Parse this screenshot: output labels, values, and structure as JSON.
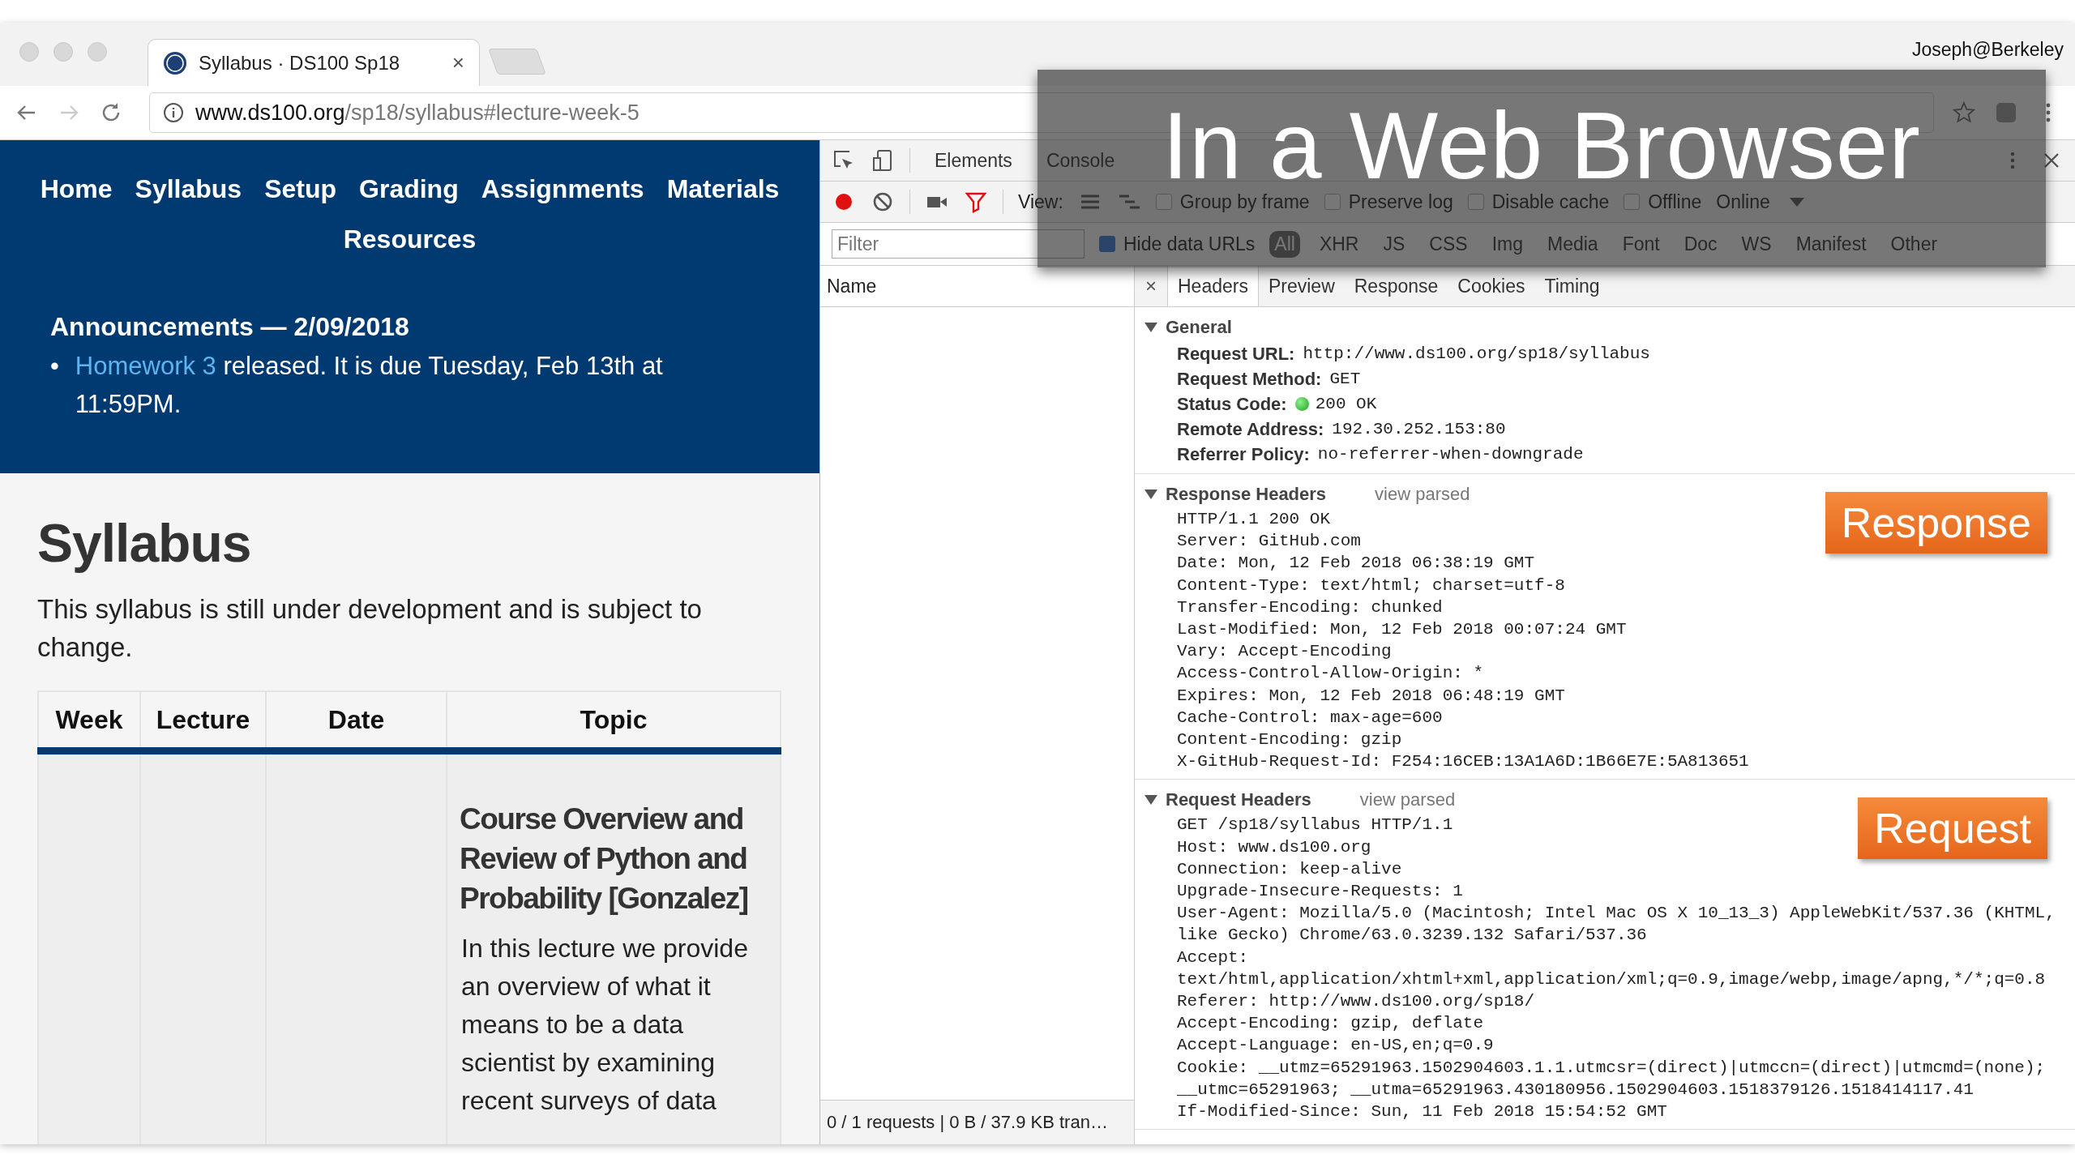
{
  "browser": {
    "tab": {
      "title": "Syllabus · DS100 Sp18",
      "close": "×",
      "selected": true
    },
    "user": "Joseph@Berkeley",
    "url": {
      "host": "www.ds100.org",
      "path": "/sp18/syllabus#lecture-week-5"
    }
  },
  "page": {
    "nav": [
      {
        "label": "Home"
      },
      {
        "label": "Syllabus"
      },
      {
        "label": "Setup"
      },
      {
        "label": "Grading"
      },
      {
        "label": "Assignments"
      },
      {
        "label": "Materials"
      },
      {
        "label": "Resources"
      }
    ],
    "announcement": {
      "title": "Announcements — 2/09/2018",
      "items": [
        {
          "bullet": "•",
          "link": "Homework 3",
          "text": " released. It is due Tuesday, Feb 13th at 11:59PM."
        }
      ]
    },
    "heading": "Syllabus",
    "intro": "This syllabus is still under development and is subject to change.",
    "table": {
      "columns": [
        "Week",
        "Lecture",
        "Date",
        "Topic"
      ],
      "rows": [
        {
          "topic_title": "Course Overview and Review of Python and Probability [Gonzalez]",
          "topic_text": "In this lecture we provide an overview of what it means to be a data scientist by examining recent surveys of data"
        }
      ]
    }
  },
  "devtools": {
    "tabs": [
      {
        "label": "Elements",
        "selected": false
      },
      {
        "label": "Console",
        "selected": false
      }
    ],
    "toolbar": {
      "recording": true,
      "view_label": "View:",
      "options": [
        {
          "label": "Group by frame",
          "checked": false
        },
        {
          "label": "Preserve log",
          "checked": false
        },
        {
          "label": "Disable cache",
          "checked": false
        },
        {
          "label": "Offline",
          "checked": false
        }
      ],
      "throttle": "Online"
    },
    "filter": {
      "placeholder": "Filter",
      "hide_data_urls": {
        "label": "Hide data URLs",
        "checked": true
      },
      "types": [
        {
          "label": "All",
          "selected": true
        },
        {
          "label": "XHR",
          "selected": false
        },
        {
          "label": "JS",
          "selected": false
        },
        {
          "label": "CSS",
          "selected": false
        },
        {
          "label": "Img",
          "selected": false
        },
        {
          "label": "Media",
          "selected": false
        },
        {
          "label": "Font",
          "selected": false
        },
        {
          "label": "Doc",
          "selected": false
        },
        {
          "label": "WS",
          "selected": false
        },
        {
          "label": "Manifest",
          "selected": false
        },
        {
          "label": "Other",
          "selected": false
        }
      ]
    },
    "name_header": "Name",
    "status": "0 / 1 requests | 0 B / 37.9 KB tran…",
    "detail": {
      "close": "×",
      "tabs": [
        {
          "label": "Headers",
          "selected": true
        },
        {
          "label": "Preview",
          "selected": false
        },
        {
          "label": "Response",
          "selected": false
        },
        {
          "label": "Cookies",
          "selected": false
        },
        {
          "label": "Timing",
          "selected": false
        }
      ],
      "sections": [
        {
          "title": "General",
          "expanded": true,
          "kind": "fields",
          "fields": [
            {
              "key": "Request URL:",
              "value": "http://www.ds100.org/sp18/syllabus",
              "kind": "text"
            },
            {
              "key": "Request Method:",
              "value": "GET",
              "kind": "text"
            },
            {
              "key": "Status Code:",
              "value": "200 OK",
              "kind": "status"
            },
            {
              "key": "Remote Address:",
              "value": "192.30.252.153:80",
              "kind": "text"
            },
            {
              "key": "Referrer Policy:",
              "value": "no-referrer-when-downgrade",
              "kind": "text"
            }
          ]
        },
        {
          "title": "Response Headers",
          "expanded": true,
          "kind": "raw",
          "action": "view parsed",
          "callout": "Response",
          "lines": [
            "HTTP/1.1 200 OK",
            "Server: GitHub.com",
            "Date: Mon, 12 Feb 2018 06:38:19 GMT",
            "Content-Type: text/html; charset=utf-8",
            "Transfer-Encoding: chunked",
            "Last-Modified: Mon, 12 Feb 2018 00:07:24 GMT",
            "Vary: Accept-Encoding",
            "Access-Control-Allow-Origin: *",
            "Expires: Mon, 12 Feb 2018 06:48:19 GMT",
            "Cache-Control: max-age=600",
            "Content-Encoding: gzip",
            "X-GitHub-Request-Id: F254:16CEB:13A1A6D:1B66E7E:5A813651"
          ]
        },
        {
          "title": "Request Headers",
          "expanded": true,
          "kind": "raw",
          "action": "view parsed",
          "callout": "Request",
          "lines": [
            "GET /sp18/syllabus HTTP/1.1",
            "Host: www.ds100.org",
            "Connection: keep-alive",
            "Upgrade-Insecure-Requests: 1",
            "User-Agent: Mozilla/5.0 (Macintosh; Intel Mac OS X 10_13_3) AppleWebKit/537.36 (KHTML, like Gecko) Chrome/63.0.3239.132 Safari/537.36",
            "Accept: text/html,application/xhtml+xml,application/xml;q=0.9,image/webp,image/apng,*/*;q=0.8",
            "Referer: http://www.ds100.org/sp18/",
            "Accept-Encoding: gzip, deflate",
            "Accept-Language: en-US,en;q=0.9",
            "Cookie: __utmz=65291963.1502904603.1.1.utmcsr=(direct)|utmccn=(direct)|utmcmd=(none); __utmc=65291963; __utma=65291963.430180956.1502904603.1518379126.1518414117.41",
            "If-Modified-Since: Sun, 11 Feb 2018 15:54:52 GMT"
          ]
        }
      ]
    }
  },
  "overlay": {
    "title": "In a Web Browser"
  }
}
